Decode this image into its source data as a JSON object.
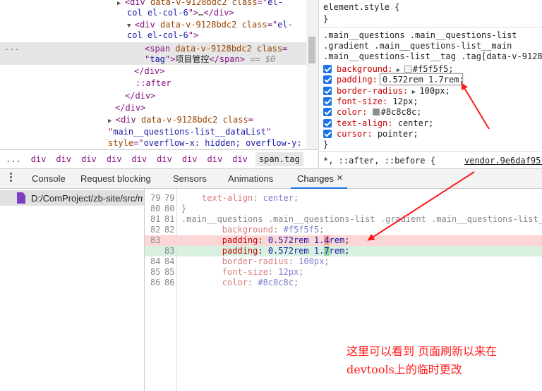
{
  "elements": {
    "lines": [
      {
        "parts": [
          {
            "c": "tri",
            "t": "▶"
          },
          {
            "c": "tag",
            "t": "<div "
          },
          {
            "c": "attr",
            "t": "data-v-9128bdc2"
          },
          {
            "c": "tag",
            "t": " "
          },
          {
            "c": "attr",
            "t": "class"
          },
          {
            "c": "tag",
            "t": "=\""
          },
          {
            "c": "val",
            "t": "el-"
          }
        ]
      },
      {
        "parts": [
          {
            "c": "val",
            "t": "col el-col-6"
          },
          {
            "c": "tag",
            "t": "\">"
          },
          {
            "c": "txt",
            "t": "…"
          },
          {
            "c": "tag",
            "t": "</div>"
          }
        ]
      },
      {
        "parts": [
          {
            "c": "tri",
            "t": "▼"
          },
          {
            "c": "tag",
            "t": "<div "
          },
          {
            "c": "attr",
            "t": "data-v-9128bdc2"
          },
          {
            "c": "tag",
            "t": " "
          },
          {
            "c": "attr",
            "t": "class"
          },
          {
            "c": "tag",
            "t": "=\""
          },
          {
            "c": "val",
            "t": "el-"
          }
        ]
      },
      {
        "parts": [
          {
            "c": "val",
            "t": "col el-col-6"
          },
          {
            "c": "tag",
            "t": "\">"
          }
        ]
      },
      {
        "parts": [
          {
            "c": "tag",
            "t": "<span "
          },
          {
            "c": "attr",
            "t": "data-v-9128bdc2"
          },
          {
            "c": "tag",
            "t": " "
          },
          {
            "c": "attr",
            "t": "class"
          },
          {
            "c": "tag",
            "t": "="
          }
        ]
      },
      {
        "parts": [
          {
            "c": "tag",
            "t": "\""
          },
          {
            "c": "val",
            "t": "tag"
          },
          {
            "c": "tag",
            "t": "\">"
          },
          {
            "c": "txt",
            "t": "项目管控"
          },
          {
            "c": "tag",
            "t": "</span>"
          },
          {
            "c": "dim",
            "t": " == $0"
          }
        ]
      },
      {
        "parts": [
          {
            "c": "tag",
            "t": "</div>"
          }
        ]
      },
      {
        "parts": [
          {
            "c": "tag",
            "t": "::after"
          }
        ]
      },
      {
        "parts": [
          {
            "c": "tag",
            "t": "</div>"
          }
        ]
      },
      {
        "parts": [
          {
            "c": "tag",
            "t": "</div>"
          }
        ]
      },
      {
        "parts": [
          {
            "c": "tri",
            "t": "▶"
          },
          {
            "c": "tag",
            "t": "<div "
          },
          {
            "c": "attr",
            "t": "data-v-9128bdc2"
          },
          {
            "c": "tag",
            "t": " "
          },
          {
            "c": "attr",
            "t": "class"
          },
          {
            "c": "tag",
            "t": "="
          }
        ]
      },
      {
        "parts": [
          {
            "c": "tag",
            "t": "\""
          },
          {
            "c": "val",
            "t": "main__questions-list__dataList"
          },
          {
            "c": "tag",
            "t": "\""
          }
        ]
      },
      {
        "parts": [
          {
            "c": "attr",
            "t": "style"
          },
          {
            "c": "tag",
            "t": "=\""
          },
          {
            "c": "val",
            "t": "overflow-x: hidden; overflow-y:"
          }
        ]
      }
    ],
    "ellipsis": "..."
  },
  "breadcrumb": [
    "...",
    "div",
    "div",
    "div",
    "div",
    "div",
    "div",
    "div",
    "div",
    "div",
    "span.tag"
  ],
  "styles": {
    "element_style": "element.style {",
    "close_brace": "}",
    "selector_lines": [
      ".main__questions .main__questions-list",
      ".gradient .main__questions-list__main",
      ".main__questions-list__tag .tag[data-v-9128"
    ],
    "props": [
      {
        "name": "background:",
        "value": "#f5f5f5;",
        "swatch": "#f5f5f5",
        "expand": true
      },
      {
        "name": "padding:",
        "value": "0.572rem 1.7rem;",
        "editing": true
      },
      {
        "name": "border-radius:",
        "value": "100px;",
        "expand": true
      },
      {
        "name": "font-size:",
        "value": "12px;"
      },
      {
        "name": "color:",
        "value": "#8c8c8c;",
        "swatch": "#8c8c8c"
      },
      {
        "name": "text-align:",
        "value": "center;"
      },
      {
        "name": "cursor:",
        "value": "pointer;"
      }
    ],
    "universal": "*, ::after, ::before {",
    "source_link": "vendor.9e6daf95."
  },
  "drawer": {
    "tabs": [
      "Console",
      "Request blocking",
      "Sensors",
      "Animations",
      "Changes"
    ],
    "active": "Changes",
    "close": "×"
  },
  "changes": {
    "file": "D:/ComProject/zb-site/src/m",
    "diff": [
      {
        "old": "79",
        "new": "79",
        "type": "ctx",
        "code": [
          {
            "c": "cprop",
            "t": "text-align"
          },
          {
            "c": "csel",
            "t": ": "
          },
          {
            "c": "cval",
            "t": "center"
          },
          {
            "c": "csel",
            "t": ";"
          }
        ],
        "indent": "    "
      },
      {
        "old": "80",
        "new": "80",
        "type": "ctx",
        "code": [
          {
            "c": "csel",
            "t": "}"
          }
        ],
        "indent": ""
      },
      {
        "old": "81",
        "new": "81",
        "type": "ctx",
        "code": [
          {
            "c": "csel",
            "t": ".main__questions .main__questions-list .gradient .main__questions-list_"
          }
        ],
        "indent": ""
      },
      {
        "old": "82",
        "new": "82",
        "type": "ctx",
        "code": [
          {
            "c": "cprop",
            "t": "background"
          },
          {
            "c": "csel",
            "t": ": "
          },
          {
            "c": "cval",
            "t": "#f5f5f5"
          },
          {
            "c": "csel",
            "t": ";"
          }
        ],
        "indent": "        "
      },
      {
        "old": "83",
        "new": "",
        "type": "del",
        "code": [
          {
            "c": "dprop",
            "t": "padding"
          },
          {
            "c": "txt",
            "t": ": "
          },
          {
            "c": "dval",
            "t": "0.572rem 1."
          },
          {
            "c": "dval hl-del",
            "t": "4"
          },
          {
            "c": "dval",
            "t": "rem"
          },
          {
            "c": "txt",
            "t": ";"
          }
        ],
        "indent": "        "
      },
      {
        "old": "",
        "new": "83",
        "type": "add",
        "code": [
          {
            "c": "dprop",
            "t": "padding"
          },
          {
            "c": "txt",
            "t": ": "
          },
          {
            "c": "dval",
            "t": "0.572rem 1."
          },
          {
            "c": "dval hl-add",
            "t": "7"
          },
          {
            "c": "dval",
            "t": "rem"
          },
          {
            "c": "txt",
            "t": ";"
          }
        ],
        "indent": "        "
      },
      {
        "old": "84",
        "new": "84",
        "type": "ctx",
        "code": [
          {
            "c": "cprop",
            "t": "border-radius"
          },
          {
            "c": "csel",
            "t": ": "
          },
          {
            "c": "cval",
            "t": "100px"
          },
          {
            "c": "csel",
            "t": ";"
          }
        ],
        "indent": "        "
      },
      {
        "old": "85",
        "new": "85",
        "type": "ctx",
        "code": [
          {
            "c": "cprop",
            "t": "font-size"
          },
          {
            "c": "csel",
            "t": ": "
          },
          {
            "c": "cval",
            "t": "12px"
          },
          {
            "c": "csel",
            "t": ";"
          }
        ],
        "indent": "        "
      },
      {
        "old": "86",
        "new": "86",
        "type": "ctx",
        "code": [
          {
            "c": "cprop",
            "t": "color"
          },
          {
            "c": "csel",
            "t": ": "
          },
          {
            "c": "cval",
            "t": "#8c8c8c"
          },
          {
            "c": "csel",
            "t": ";"
          }
        ],
        "indent": "        "
      }
    ]
  },
  "annotation": {
    "line1": "这里可以看到 页面刷新以来在",
    "line2": "devtools上的临时更改",
    "color": "#ff1a1a"
  }
}
